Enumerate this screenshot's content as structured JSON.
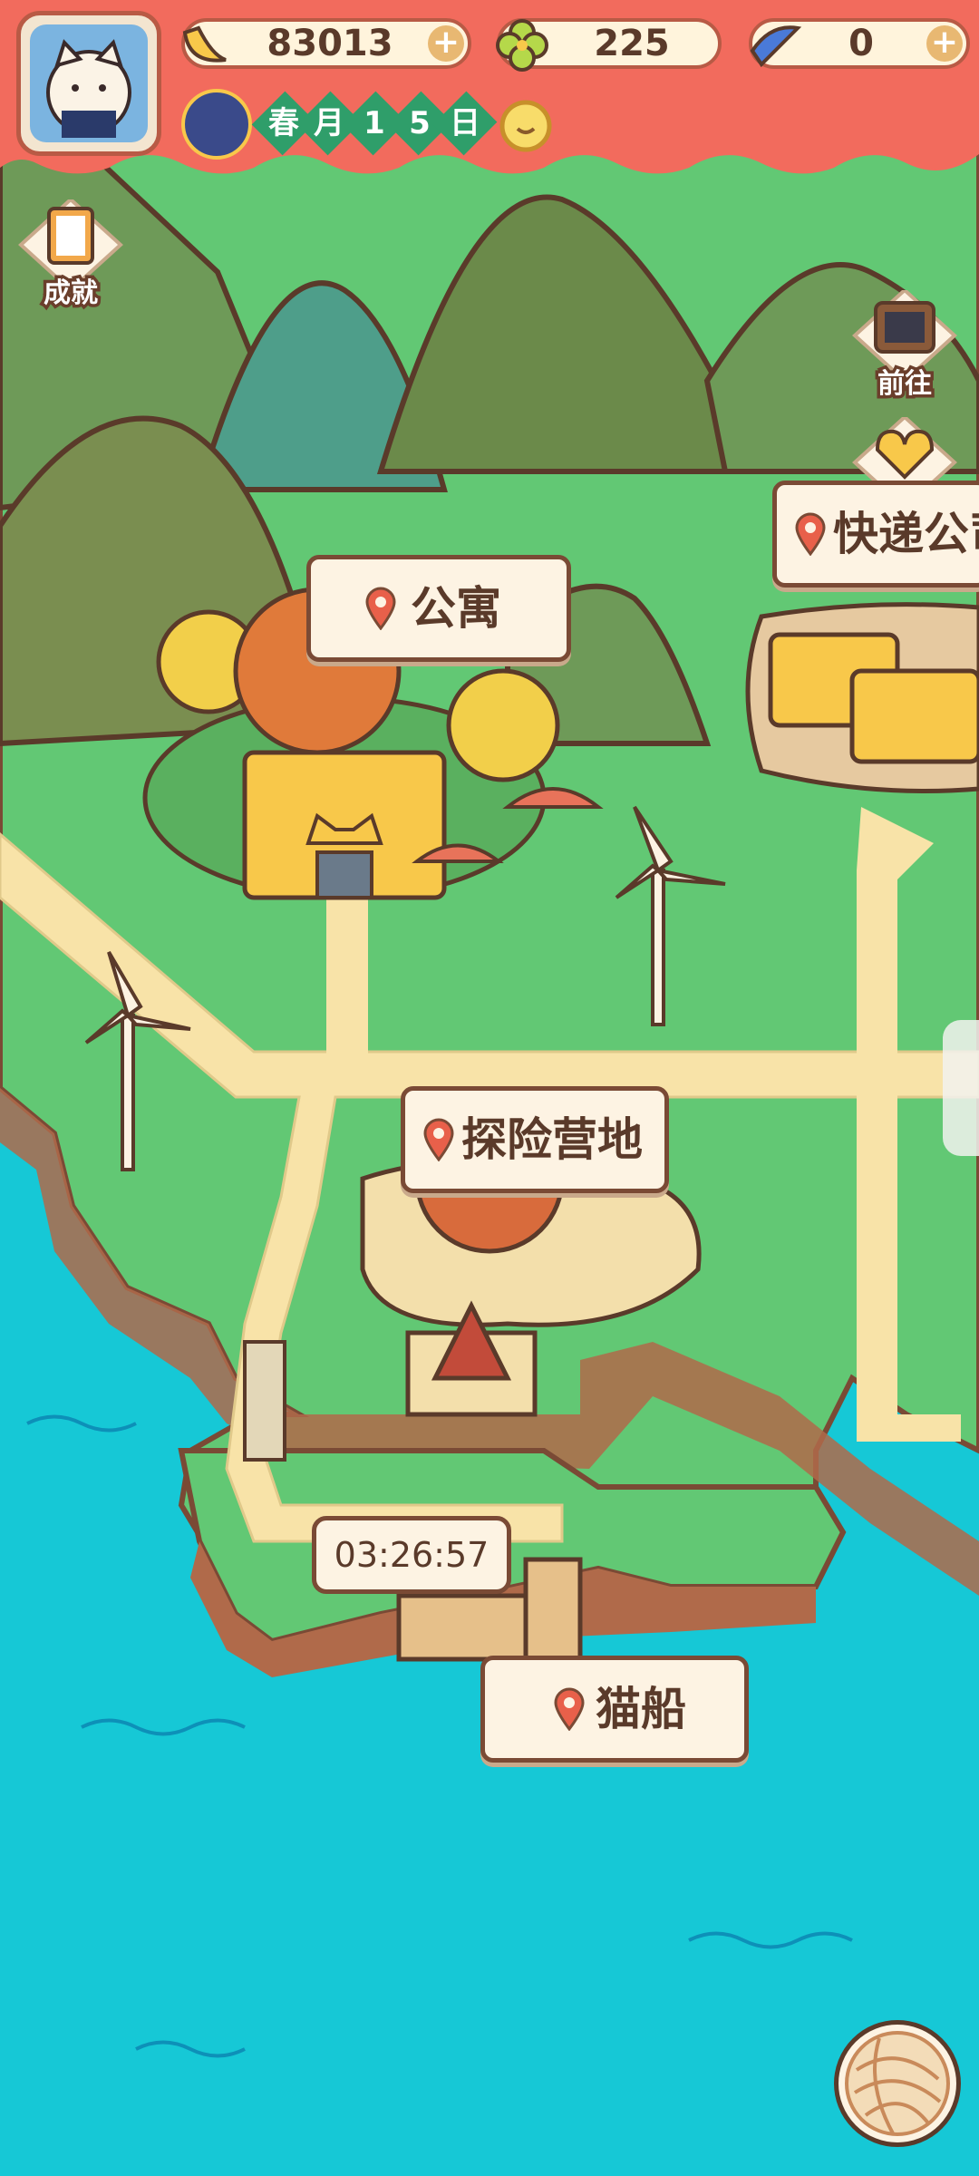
{
  "hud": {
    "bananas": {
      "value": "83013",
      "icon": "banana-icon",
      "plus_icon": "plus-icon"
    },
    "clovers": {
      "value": "225",
      "icon": "clover-icon"
    },
    "fish": {
      "value": "0",
      "icon": "blue-banana-icon",
      "plus_icon": "plus-icon"
    },
    "date": {
      "season": "春",
      "month": "月",
      "d1": "1",
      "d2": "5",
      "day": "日"
    },
    "weather_icon": "sun-icon",
    "avatar_icon": "cat-avatar-icon"
  },
  "side": {
    "achievements": "成就",
    "goto": "前往",
    "wish": "心愿"
  },
  "places": {
    "apartment": "公寓",
    "courier": "快递公司",
    "camp": "探险营地",
    "catboat": "猫船"
  },
  "timer": "03:26:57",
  "colors": {
    "sea": "#16c8d6",
    "grass": "#62c874",
    "path": "#f8e3a8",
    "header": "#f26b5d",
    "outline": "#7a4a35"
  }
}
